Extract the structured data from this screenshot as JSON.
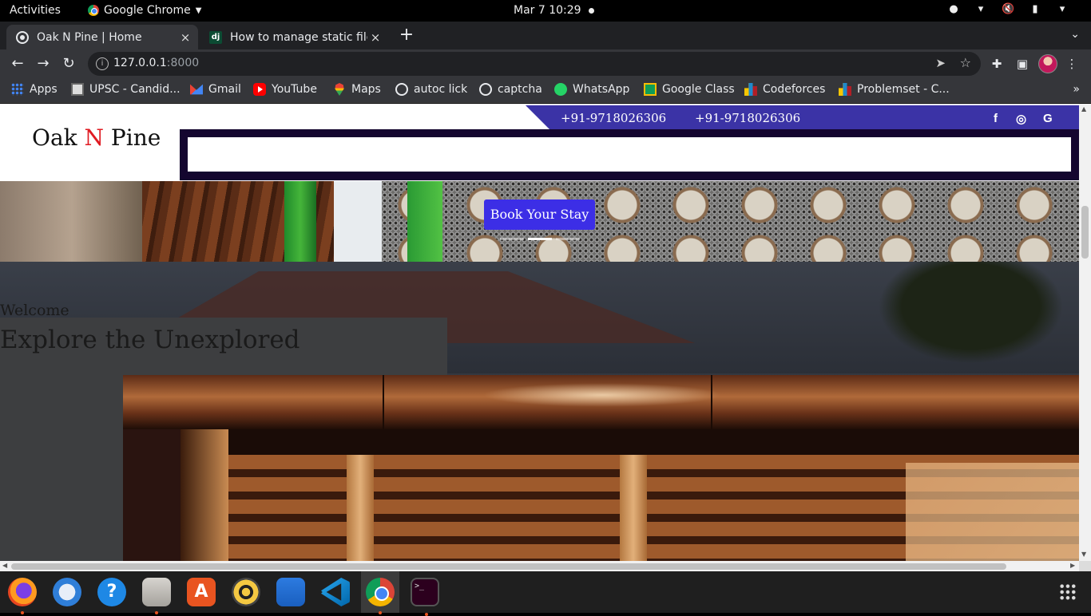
{
  "system_bar": {
    "activities": "Activities",
    "app_name": "Google Chrome",
    "clock": "Mar 7  10:29"
  },
  "browser": {
    "tabs": [
      {
        "title": "Oak N Pine | Home",
        "close": "×"
      },
      {
        "title": "How to manage static file",
        "close": "×"
      }
    ],
    "new_tab": "+",
    "tab_search": "⌄",
    "url_host": "127.0.0.1",
    "url_port": ":8000",
    "bookmarks": [
      {
        "label": "Apps",
        "icon": "apps-grid-icon"
      },
      {
        "label": "UPSC - Candid...",
        "icon": "upsc-icon"
      },
      {
        "label": "Gmail",
        "icon": "gmail-icon"
      },
      {
        "label": "YouTube",
        "icon": "youtube-icon"
      },
      {
        "label": "Maps",
        "icon": "maps-icon"
      },
      {
        "label": "autoc lick",
        "icon": "globe-icon"
      },
      {
        "label": "captcha",
        "icon": "globe-icon"
      },
      {
        "label": "WhatsApp",
        "icon": "whatsapp-icon"
      },
      {
        "label": "Google Class",
        "icon": "google-classroom-icon"
      },
      {
        "label": "Codeforces",
        "icon": "codeforces-icon"
      },
      {
        "label": "Problemset - C...",
        "icon": "codeforces-icon"
      }
    ],
    "bookmarks_more": "»"
  },
  "site": {
    "brand_first": "Oak ",
    "brand_accent": "N",
    "brand_last": " Pine",
    "brand_accent_color": "#e01b22",
    "phones": [
      "+91-9718026306",
      "+91-9718026306"
    ],
    "social": [
      "f",
      "◎",
      "G"
    ],
    "strip_color": "#3b33a6",
    "navbar_color": "#14062f",
    "hero": {
      "button": "Book Your Stay",
      "button_color": "#3c2ee6",
      "slides": 3,
      "active_slide": 2
    },
    "welcome": {
      "label": "Welcome",
      "title": "Explore the Unexplored"
    }
  }
}
